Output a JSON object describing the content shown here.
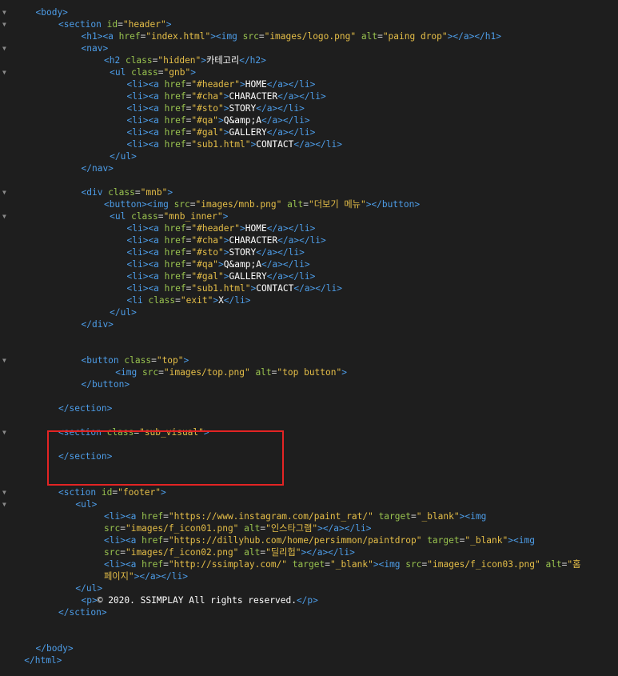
{
  "colors": {
    "background": "#1e1e1e",
    "tag": "#4d9de8",
    "attribute": "#99c34f",
    "value": "#e6bf48",
    "text": "#ffffff",
    "highlight": "#e32424",
    "fold": "#8a8a8a"
  },
  "fold_icon": "chevron-down-icon",
  "fold_glyph": "▼",
  "highlight_label": "sub_visual section highlight",
  "lines": [
    {
      "fold": true,
      "indent": 1,
      "tokens": [
        {
          "t": "tg",
          "v": "<body>"
        }
      ]
    },
    {
      "fold": true,
      "indent": 2,
      "tokens": [
        {
          "t": "tg",
          "v": "<section "
        },
        {
          "t": "at",
          "v": "id"
        },
        {
          "t": "eq",
          "v": "="
        },
        {
          "t": "st",
          "v": "\"header\""
        },
        {
          "t": "tg",
          "v": ">"
        }
      ]
    },
    {
      "fold": false,
      "indent": 3,
      "tokens": [
        {
          "t": "tg",
          "v": "<h1><a "
        },
        {
          "t": "at",
          "v": "href"
        },
        {
          "t": "eq",
          "v": "="
        },
        {
          "t": "st",
          "v": "\"index.html\""
        },
        {
          "t": "tg",
          "v": "><img "
        },
        {
          "t": "at",
          "v": "src"
        },
        {
          "t": "eq",
          "v": "="
        },
        {
          "t": "st",
          "v": "\"images/logo.png\""
        },
        {
          "t": "tx",
          "v": " "
        },
        {
          "t": "at",
          "v": "alt"
        },
        {
          "t": "eq",
          "v": "="
        },
        {
          "t": "st",
          "v": "\"paing drop\""
        },
        {
          "t": "tg",
          "v": "></a></h1>"
        }
      ]
    },
    {
      "fold": true,
      "indent": 3,
      "tokens": [
        {
          "t": "tg",
          "v": "<nav>"
        }
      ]
    },
    {
      "fold": false,
      "indent": 4,
      "tokens": [
        {
          "t": "tg",
          "v": "<h2 "
        },
        {
          "t": "at",
          "v": "class"
        },
        {
          "t": "eq",
          "v": "="
        },
        {
          "t": "st",
          "v": "\"hidden\""
        },
        {
          "t": "tg",
          "v": ">"
        },
        {
          "t": "tx",
          "v": "카테고리"
        },
        {
          "t": "tg",
          "v": "</h2>"
        }
      ]
    },
    {
      "fold": true,
      "indent": 4.25,
      "tokens": [
        {
          "t": "tg",
          "v": "<ul "
        },
        {
          "t": "at",
          "v": "class"
        },
        {
          "t": "eq",
          "v": "="
        },
        {
          "t": "st",
          "v": "\"gnb\""
        },
        {
          "t": "tg",
          "v": ">"
        }
      ]
    },
    {
      "fold": false,
      "indent": 5,
      "tokens": [
        {
          "t": "tg",
          "v": "<li><a "
        },
        {
          "t": "at",
          "v": "href"
        },
        {
          "t": "eq",
          "v": "="
        },
        {
          "t": "st",
          "v": "\"#header\""
        },
        {
          "t": "tg",
          "v": ">"
        },
        {
          "t": "tx",
          "v": "HOME"
        },
        {
          "t": "tg",
          "v": "</a></li>"
        }
      ]
    },
    {
      "fold": false,
      "indent": 5,
      "tokens": [
        {
          "t": "tg",
          "v": "<li><a "
        },
        {
          "t": "at",
          "v": "href"
        },
        {
          "t": "eq",
          "v": "="
        },
        {
          "t": "st",
          "v": "\"#cha\""
        },
        {
          "t": "tg",
          "v": ">"
        },
        {
          "t": "tx",
          "v": "CHARACTER"
        },
        {
          "t": "tg",
          "v": "</a></li>"
        }
      ]
    },
    {
      "fold": false,
      "indent": 5,
      "tokens": [
        {
          "t": "tg",
          "v": "<li><a "
        },
        {
          "t": "at",
          "v": "href"
        },
        {
          "t": "eq",
          "v": "="
        },
        {
          "t": "st",
          "v": "\"#sto\""
        },
        {
          "t": "tg",
          "v": ">"
        },
        {
          "t": "tx",
          "v": "STORY"
        },
        {
          "t": "tg",
          "v": "</a></li>"
        }
      ]
    },
    {
      "fold": false,
      "indent": 5,
      "tokens": [
        {
          "t": "tg",
          "v": "<li><a "
        },
        {
          "t": "at",
          "v": "href"
        },
        {
          "t": "eq",
          "v": "="
        },
        {
          "t": "st",
          "v": "\"#qa\""
        },
        {
          "t": "tg",
          "v": ">"
        },
        {
          "t": "tx",
          "v": "Q&amp;A"
        },
        {
          "t": "tg",
          "v": "</a></li>"
        }
      ]
    },
    {
      "fold": false,
      "indent": 5,
      "tokens": [
        {
          "t": "tg",
          "v": "<li><a "
        },
        {
          "t": "at",
          "v": "href"
        },
        {
          "t": "eq",
          "v": "="
        },
        {
          "t": "st",
          "v": "\"#gal\""
        },
        {
          "t": "tg",
          "v": ">"
        },
        {
          "t": "tx",
          "v": "GALLERY"
        },
        {
          "t": "tg",
          "v": "</a></li>"
        }
      ]
    },
    {
      "fold": false,
      "indent": 5,
      "tokens": [
        {
          "t": "tg",
          "v": "<li><a "
        },
        {
          "t": "at",
          "v": "href"
        },
        {
          "t": "eq",
          "v": "="
        },
        {
          "t": "st",
          "v": "\"sub1.html\""
        },
        {
          "t": "tg",
          "v": ">"
        },
        {
          "t": "tx",
          "v": "CONTACT"
        },
        {
          "t": "tg",
          "v": "</a></li>"
        }
      ]
    },
    {
      "fold": false,
      "indent": 4.25,
      "tokens": [
        {
          "t": "tg",
          "v": "</ul>"
        }
      ]
    },
    {
      "fold": false,
      "indent": 3,
      "tokens": [
        {
          "t": "tg",
          "v": "</nav>"
        }
      ]
    },
    {
      "fold": false,
      "indent": 0,
      "tokens": []
    },
    {
      "fold": true,
      "indent": 3,
      "tokens": [
        {
          "t": "tg",
          "v": "<div "
        },
        {
          "t": "at",
          "v": "class"
        },
        {
          "t": "eq",
          "v": "="
        },
        {
          "t": "st",
          "v": "\"mnb\""
        },
        {
          "t": "tg",
          "v": ">"
        }
      ]
    },
    {
      "fold": false,
      "indent": 4,
      "tokens": [
        {
          "t": "tg",
          "v": "<button><img "
        },
        {
          "t": "at",
          "v": "src"
        },
        {
          "t": "eq",
          "v": "="
        },
        {
          "t": "st",
          "v": "\"images/mnb.png\""
        },
        {
          "t": "tx",
          "v": " "
        },
        {
          "t": "at",
          "v": "alt"
        },
        {
          "t": "eq",
          "v": "="
        },
        {
          "t": "st",
          "v": "\"더보기 메뉴\""
        },
        {
          "t": "tg",
          "v": "></button>"
        }
      ]
    },
    {
      "fold": true,
      "indent": 4.25,
      "tokens": [
        {
          "t": "tg",
          "v": "<ul "
        },
        {
          "t": "at",
          "v": "class"
        },
        {
          "t": "eq",
          "v": "="
        },
        {
          "t": "st",
          "v": "\"mnb_inner\""
        },
        {
          "t": "tg",
          "v": ">"
        }
      ]
    },
    {
      "fold": false,
      "indent": 5,
      "tokens": [
        {
          "t": "tg",
          "v": "<li><a "
        },
        {
          "t": "at",
          "v": "href"
        },
        {
          "t": "eq",
          "v": "="
        },
        {
          "t": "st",
          "v": "\"#header\""
        },
        {
          "t": "tg",
          "v": ">"
        },
        {
          "t": "tx",
          "v": "HOME"
        },
        {
          "t": "tg",
          "v": "</a></li>"
        }
      ]
    },
    {
      "fold": false,
      "indent": 5,
      "tokens": [
        {
          "t": "tg",
          "v": "<li><a "
        },
        {
          "t": "at",
          "v": "href"
        },
        {
          "t": "eq",
          "v": "="
        },
        {
          "t": "st",
          "v": "\"#cha\""
        },
        {
          "t": "tg",
          "v": ">"
        },
        {
          "t": "tx",
          "v": "CHARACTER"
        },
        {
          "t": "tg",
          "v": "</a></li>"
        }
      ]
    },
    {
      "fold": false,
      "indent": 5,
      "tokens": [
        {
          "t": "tg",
          "v": "<li><a "
        },
        {
          "t": "at",
          "v": "href"
        },
        {
          "t": "eq",
          "v": "="
        },
        {
          "t": "st",
          "v": "\"#sto\""
        },
        {
          "t": "tg",
          "v": ">"
        },
        {
          "t": "tx",
          "v": "STORY"
        },
        {
          "t": "tg",
          "v": "</a></li>"
        }
      ]
    },
    {
      "fold": false,
      "indent": 5,
      "tokens": [
        {
          "t": "tg",
          "v": "<li><a "
        },
        {
          "t": "at",
          "v": "href"
        },
        {
          "t": "eq",
          "v": "="
        },
        {
          "t": "st",
          "v": "\"#qa\""
        },
        {
          "t": "tg",
          "v": ">"
        },
        {
          "t": "tx",
          "v": "Q&amp;A"
        },
        {
          "t": "tg",
          "v": "</a></li>"
        }
      ]
    },
    {
      "fold": false,
      "indent": 5,
      "tokens": [
        {
          "t": "tg",
          "v": "<li><a "
        },
        {
          "t": "at",
          "v": "href"
        },
        {
          "t": "eq",
          "v": "="
        },
        {
          "t": "st",
          "v": "\"#gal\""
        },
        {
          "t": "tg",
          "v": ">"
        },
        {
          "t": "tx",
          "v": "GALLERY"
        },
        {
          "t": "tg",
          "v": "</a></li>"
        }
      ]
    },
    {
      "fold": false,
      "indent": 5,
      "tokens": [
        {
          "t": "tg",
          "v": "<li><a "
        },
        {
          "t": "at",
          "v": "href"
        },
        {
          "t": "eq",
          "v": "="
        },
        {
          "t": "st",
          "v": "\"sub1.html\""
        },
        {
          "t": "tg",
          "v": ">"
        },
        {
          "t": "tx",
          "v": "CONTACT"
        },
        {
          "t": "tg",
          "v": "</a></li>"
        }
      ]
    },
    {
      "fold": false,
      "indent": 5,
      "tokens": [
        {
          "t": "tg",
          "v": "<li "
        },
        {
          "t": "at",
          "v": "class"
        },
        {
          "t": "eq",
          "v": "="
        },
        {
          "t": "st",
          "v": "\"exit\""
        },
        {
          "t": "tg",
          "v": ">"
        },
        {
          "t": "tx",
          "v": "X"
        },
        {
          "t": "tg",
          "v": "</li>"
        }
      ]
    },
    {
      "fold": false,
      "indent": 4.25,
      "tokens": [
        {
          "t": "tg",
          "v": "</ul>"
        }
      ]
    },
    {
      "fold": false,
      "indent": 3,
      "tokens": [
        {
          "t": "tg",
          "v": "</div>"
        }
      ]
    },
    {
      "fold": false,
      "indent": 0,
      "tokens": []
    },
    {
      "fold": false,
      "indent": 0,
      "tokens": []
    },
    {
      "fold": true,
      "indent": 3,
      "tokens": [
        {
          "t": "tg",
          "v": "<button "
        },
        {
          "t": "at",
          "v": "class"
        },
        {
          "t": "eq",
          "v": "="
        },
        {
          "t": "st",
          "v": "\"top\""
        },
        {
          "t": "tg",
          "v": ">"
        }
      ]
    },
    {
      "fold": false,
      "indent": 4.5,
      "tokens": [
        {
          "t": "tg",
          "v": "<img "
        },
        {
          "t": "at",
          "v": "src"
        },
        {
          "t": "eq",
          "v": "="
        },
        {
          "t": "st",
          "v": "\"images/top.png\""
        },
        {
          "t": "tx",
          "v": " "
        },
        {
          "t": "at",
          "v": "alt"
        },
        {
          "t": "eq",
          "v": "="
        },
        {
          "t": "st",
          "v": "\"top button\""
        },
        {
          "t": "tg",
          "v": ">"
        }
      ]
    },
    {
      "fold": false,
      "indent": 3,
      "tokens": [
        {
          "t": "tg",
          "v": "</button>"
        }
      ]
    },
    {
      "fold": false,
      "indent": 0,
      "tokens": []
    },
    {
      "fold": false,
      "indent": 2,
      "tokens": [
        {
          "t": "tg",
          "v": "</section>"
        }
      ]
    },
    {
      "fold": false,
      "indent": 0,
      "tokens": []
    },
    {
      "fold": true,
      "indent": 2,
      "tokens": [
        {
          "t": "tg",
          "v": "<section "
        },
        {
          "t": "at",
          "v": "class"
        },
        {
          "t": "eq",
          "v": "="
        },
        {
          "t": "st",
          "v": "\"sub_visual\""
        },
        {
          "t": "tg",
          "v": ">"
        }
      ]
    },
    {
      "fold": false,
      "indent": 0,
      "tokens": []
    },
    {
      "fold": false,
      "indent": 2,
      "tokens": [
        {
          "t": "tg",
          "v": "</section>"
        }
      ]
    },
    {
      "fold": false,
      "indent": 0,
      "tokens": []
    },
    {
      "fold": false,
      "indent": 0,
      "tokens": []
    },
    {
      "fold": true,
      "indent": 2,
      "tokens": [
        {
          "t": "tg",
          "v": "<sction "
        },
        {
          "t": "at",
          "v": "id"
        },
        {
          "t": "eq",
          "v": "="
        },
        {
          "t": "st",
          "v": "\"footer\""
        },
        {
          "t": "tg",
          "v": ">"
        }
      ]
    },
    {
      "fold": true,
      "indent": 2.75,
      "tokens": [
        {
          "t": "tg",
          "v": "<ul>"
        }
      ]
    },
    {
      "fold": false,
      "indent": 4,
      "tokens": [
        {
          "t": "tg",
          "v": "<li><a "
        },
        {
          "t": "at",
          "v": "href"
        },
        {
          "t": "eq",
          "v": "="
        },
        {
          "t": "st",
          "v": "\"https://www.instagram.com/paint_rat/\""
        },
        {
          "t": "tx",
          "v": " "
        },
        {
          "t": "at",
          "v": "target"
        },
        {
          "t": "eq",
          "v": "="
        },
        {
          "t": "st",
          "v": "\"_blank\""
        },
        {
          "t": "tg",
          "v": "><img"
        }
      ]
    },
    {
      "fold": false,
      "indent": 4,
      "tokens": [
        {
          "t": "at",
          "v": "src"
        },
        {
          "t": "eq",
          "v": "="
        },
        {
          "t": "st",
          "v": "\"images/f_icon01.png\""
        },
        {
          "t": "tx",
          "v": " "
        },
        {
          "t": "at",
          "v": "alt"
        },
        {
          "t": "eq",
          "v": "="
        },
        {
          "t": "st",
          "v": "\"인스타그램\""
        },
        {
          "t": "tg",
          "v": "></a></li>"
        }
      ]
    },
    {
      "fold": false,
      "indent": 4,
      "tokens": [
        {
          "t": "tg",
          "v": "<li><a "
        },
        {
          "t": "at",
          "v": "href"
        },
        {
          "t": "eq",
          "v": "="
        },
        {
          "t": "st",
          "v": "\"https://dillyhub.com/home/persimmon/paintdrop\""
        },
        {
          "t": "tx",
          "v": " "
        },
        {
          "t": "at",
          "v": "target"
        },
        {
          "t": "eq",
          "v": "="
        },
        {
          "t": "st",
          "v": "\"_blank\""
        },
        {
          "t": "tg",
          "v": "><img"
        }
      ]
    },
    {
      "fold": false,
      "indent": 4,
      "tokens": [
        {
          "t": "at",
          "v": "src"
        },
        {
          "t": "eq",
          "v": "="
        },
        {
          "t": "st",
          "v": "\"images/f_icon02.png\""
        },
        {
          "t": "tx",
          "v": " "
        },
        {
          "t": "at",
          "v": "alt"
        },
        {
          "t": "eq",
          "v": "="
        },
        {
          "t": "st",
          "v": "\"딜리헙\""
        },
        {
          "t": "tg",
          "v": "></a></li>"
        }
      ]
    },
    {
      "fold": false,
      "indent": 4,
      "tokens": [
        {
          "t": "tg",
          "v": "<li><a "
        },
        {
          "t": "at",
          "v": "href"
        },
        {
          "t": "eq",
          "v": "="
        },
        {
          "t": "st",
          "v": "\"http://ssimplay.com/\""
        },
        {
          "t": "tx",
          "v": " "
        },
        {
          "t": "at",
          "v": "target"
        },
        {
          "t": "eq",
          "v": "="
        },
        {
          "t": "st",
          "v": "\"_blank\""
        },
        {
          "t": "tg",
          "v": "><img "
        },
        {
          "t": "at",
          "v": "src"
        },
        {
          "t": "eq",
          "v": "="
        },
        {
          "t": "st",
          "v": "\"images/f_icon03.png\""
        },
        {
          "t": "tx",
          "v": " "
        },
        {
          "t": "at",
          "v": "alt"
        },
        {
          "t": "eq",
          "v": "="
        },
        {
          "t": "st",
          "v": "\"홈"
        }
      ]
    },
    {
      "fold": false,
      "indent": 4,
      "tokens": [
        {
          "t": "st",
          "v": "페이지\""
        },
        {
          "t": "tg",
          "v": "></a></li>"
        }
      ]
    },
    {
      "fold": false,
      "indent": 2.75,
      "tokens": [
        {
          "t": "tg",
          "v": "</ul>"
        }
      ]
    },
    {
      "fold": false,
      "indent": 3,
      "tokens": [
        {
          "t": "tg",
          "v": "<p>"
        },
        {
          "t": "tx",
          "v": "© 2020. SSIMPLAY All rights reserved."
        },
        {
          "t": "tg",
          "v": "</p>"
        }
      ]
    },
    {
      "fold": false,
      "indent": 2,
      "tokens": [
        {
          "t": "tg",
          "v": "</sction>"
        }
      ]
    },
    {
      "fold": false,
      "indent": 0,
      "tokens": []
    },
    {
      "fold": false,
      "indent": 0,
      "tokens": []
    },
    {
      "fold": false,
      "indent": 1,
      "tokens": [
        {
          "t": "tg",
          "v": "</body>"
        }
      ]
    },
    {
      "fold": false,
      "indent": 0.5,
      "tokens": [
        {
          "t": "tg",
          "v": "</html>"
        }
      ]
    }
  ]
}
